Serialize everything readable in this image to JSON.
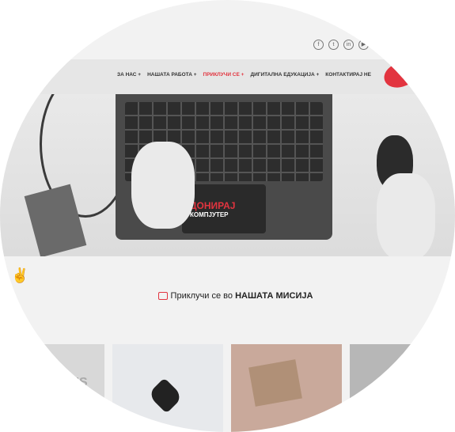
{
  "social": [
    "f",
    "t",
    "in",
    "▶"
  ],
  "nav": {
    "items": [
      "ЗА НАС +",
      "НАШАТА РАБОТА +",
      "ПРИКЛУЧИ СЕ +",
      "ДИГИТАЛНА ЕДУКАЦИЈА +",
      "КОНТАКТИРАЈ НЕ"
    ],
    "active_index": 2
  },
  "hero": {
    "brand_top": "ДОНИРАЈ",
    "brand_bottom": "КОМПЈУТЕР"
  },
  "mission": {
    "prefix": "Приклучи се во ",
    "bold": "НАШАТА МИСИЈА"
  },
  "cards": {
    "first_card_text": "ONS"
  },
  "colors": {
    "accent": "#e2343f"
  }
}
